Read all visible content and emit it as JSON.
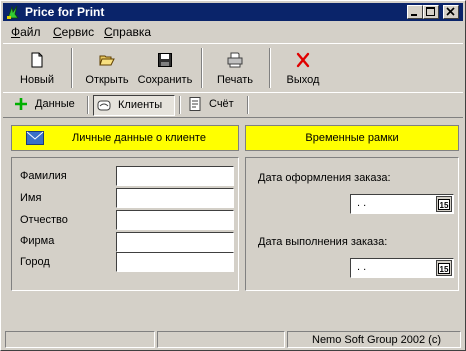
{
  "window": {
    "title": "Price for Print"
  },
  "menu": [
    {
      "label_u": "Ф",
      "label_rest": "айл"
    },
    {
      "label_u": "С",
      "label_rest": "ервис"
    },
    {
      "label_u": "С",
      "label_rest": "правка"
    }
  ],
  "toolbar": {
    "new_label": "Новый",
    "open_label": "Открыть",
    "save_label": "Сохранить",
    "print_label": "Печать",
    "exit_label": "Выход"
  },
  "tabs": [
    {
      "label": "Данные"
    },
    {
      "label": "Клиенты"
    },
    {
      "label": "Счёт"
    }
  ],
  "client_panel": {
    "header": "Личные данные о клиенте",
    "fields": [
      {
        "label": "Фамилия",
        "value": ""
      },
      {
        "label": "Имя",
        "value": ""
      },
      {
        "label": "Отчество",
        "value": ""
      },
      {
        "label": "Фирма",
        "value": ""
      },
      {
        "label": "Город",
        "value": ""
      }
    ]
  },
  "time_panel": {
    "header": "Временные рамки",
    "order_date_label": "Дата оформления заказа:",
    "order_date_value": " .  .",
    "complete_date_label": "Дата выполнения заказа:",
    "complete_date_value": " .  .",
    "calendar_button": "15"
  },
  "status": {
    "company": "Nemo Soft Group 2002 (c)"
  },
  "colors": {
    "title_bar": "#0a246a",
    "header_bg": "#ffff00",
    "face": "#d4d0c8"
  }
}
